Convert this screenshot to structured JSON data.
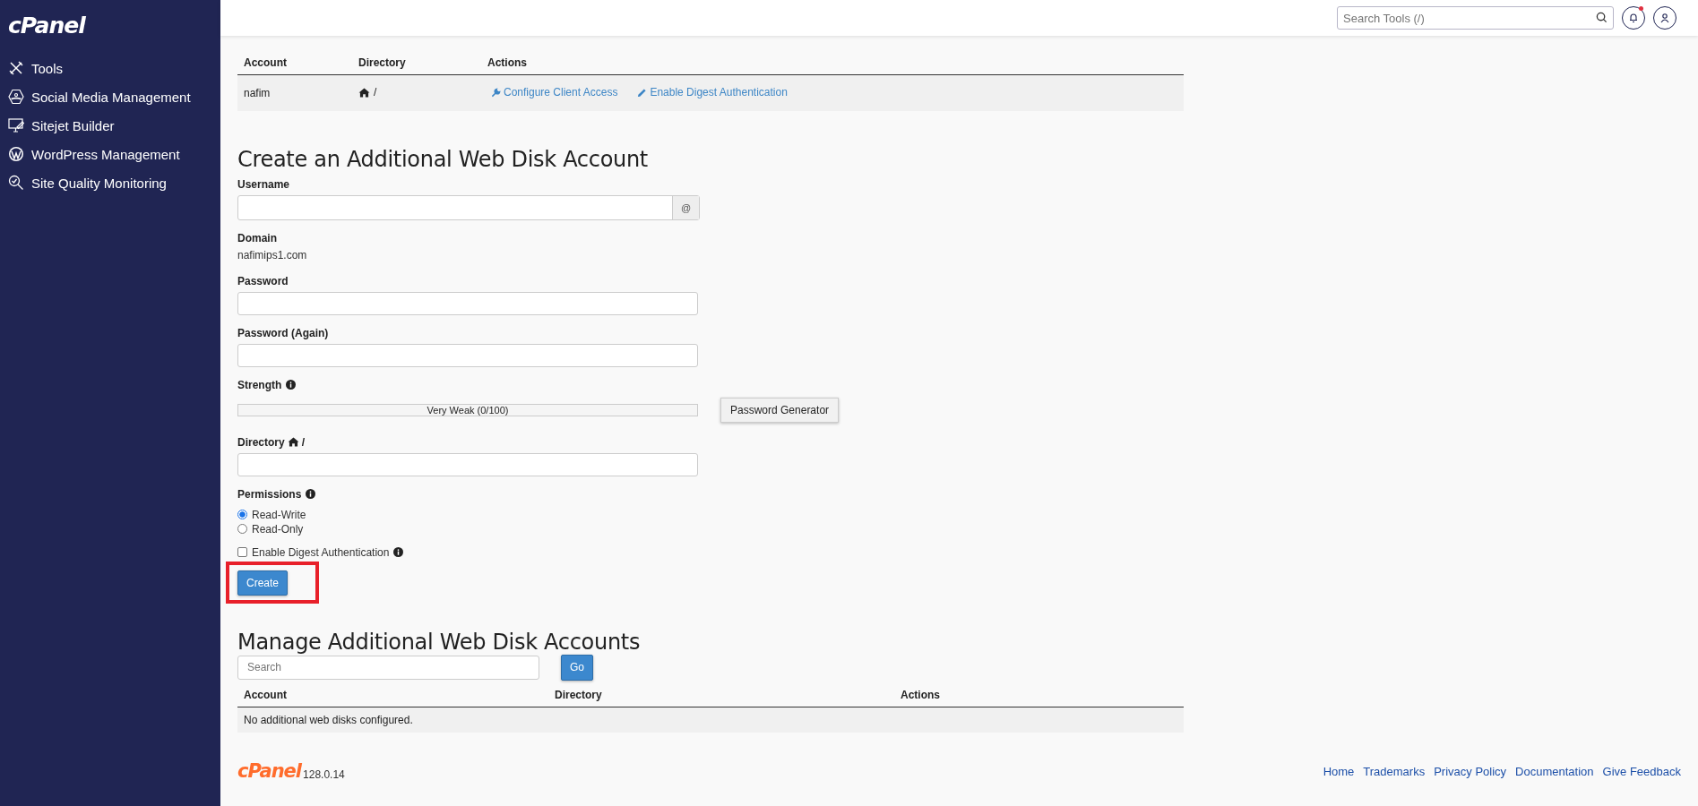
{
  "sidebar": {
    "logo": "cPanel",
    "items": [
      {
        "label": "Tools",
        "kind": "tools"
      },
      {
        "label": "Social Media Management",
        "kind": "social"
      },
      {
        "label": "Sitejet Builder",
        "kind": "sitejet"
      },
      {
        "label": "WordPress Management",
        "kind": "wordpress"
      },
      {
        "label": "Site Quality Monitoring",
        "kind": "quality"
      }
    ]
  },
  "header": {
    "search": {
      "placeholder": "Search Tools (/)"
    },
    "notifications": {
      "unread": true
    }
  },
  "main_account": {
    "columns": [
      "Account",
      "Directory",
      "Actions"
    ],
    "rows": [
      {
        "account": "nafim",
        "directory": "/",
        "actions": [
          {
            "label": "Configure Client Access",
            "kind": "wrench"
          },
          {
            "label": "Enable Digest Authentication",
            "kind": "pencil"
          }
        ]
      }
    ]
  },
  "create_form": {
    "title": "Create an Additional Web Disk Account",
    "username": {
      "label": "Username",
      "addon": "@"
    },
    "domain": {
      "label": "Domain",
      "value": "nafimips1.com"
    },
    "password": {
      "label": "Password"
    },
    "password_again": {
      "label": "Password (Again)"
    },
    "strength": {
      "label": "Strength",
      "level": 0,
      "reading": "Very Weak (0/100)"
    },
    "password_generator": "Password Generator",
    "directory": {
      "label": "Directory",
      "suffix": "/"
    },
    "permissions": {
      "label": "Permissions",
      "options": [
        {
          "label": "Read-Write",
          "selected": true
        },
        {
          "label": "Read-Only",
          "selected": false
        }
      ]
    },
    "digest": {
      "label": "Enable Digest Authentication",
      "checked": false
    },
    "submit": "Create"
  },
  "manage": {
    "title": "Manage Additional Web Disk Accounts",
    "search": {
      "placeholder": "Search"
    },
    "go": "Go",
    "columns": [
      "Account",
      "Directory",
      "Actions"
    ],
    "empty": "No additional web disks configured."
  },
  "footer": {
    "logo": "cPanel",
    "version": "128.0.14",
    "links": [
      "Home",
      "Trademarks",
      "Privacy Policy",
      "Documentation",
      "Give Feedback"
    ]
  }
}
